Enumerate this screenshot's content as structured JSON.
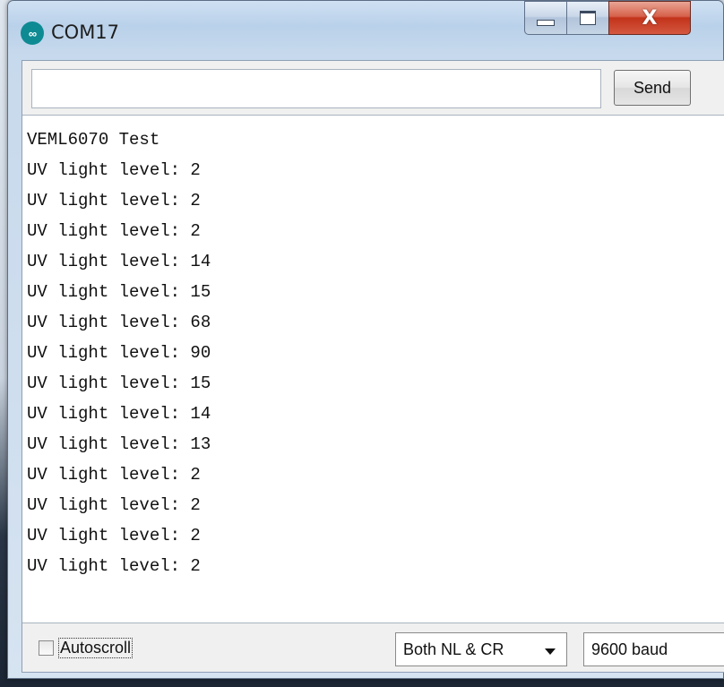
{
  "window": {
    "title": "COM17",
    "app_icon_glyph": "∞"
  },
  "caption_buttons": {
    "close_glyph": "X"
  },
  "send_bar": {
    "input_value": "",
    "send_label": "Send"
  },
  "output": {
    "lines": [
      "VEML6070 Test",
      "UV light level: 2",
      "UV light level: 2",
      "UV light level: 2",
      "UV light level: 14",
      "UV light level: 15",
      "UV light level: 68",
      "UV light level: 90",
      "UV light level: 15",
      "UV light level: 14",
      "UV light level: 13",
      "UV light level: 2",
      "UV light level: 2",
      "UV light level: 2",
      "UV light level: 2"
    ]
  },
  "bottom": {
    "autoscroll_label": "Autoscroll",
    "autoscroll_checked": false,
    "line_ending": "Both NL & CR",
    "baud_rate": "9600 baud"
  },
  "colors": {
    "close_red": "#c2331b",
    "arduino_teal": "#0e8a93"
  }
}
